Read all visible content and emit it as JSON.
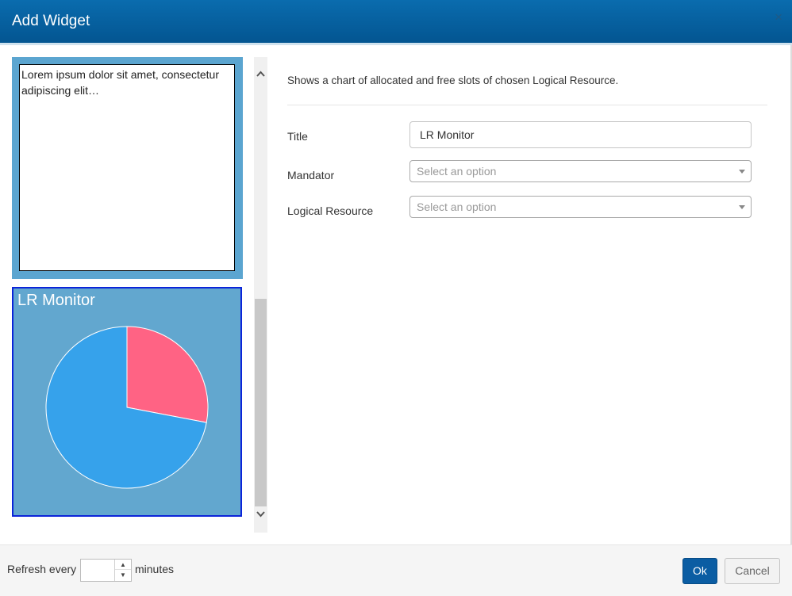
{
  "dialog": {
    "title": "Add Widget",
    "close_glyph": "×"
  },
  "left_pane": {
    "text_tile": {
      "text": "Lorem ipsum dolor sit amet, consectetur adipiscing elit…"
    },
    "chart_tile": {
      "title": "LR Monitor"
    }
  },
  "chart_data": {
    "type": "pie",
    "title": "LR Monitor",
    "slices": [
      {
        "value": 28,
        "color": "#ff6384"
      },
      {
        "value": 72,
        "color": "#36a2eb"
      }
    ],
    "start_angle_deg": -90
  },
  "scrollbar": {
    "up_glyph": "⌃",
    "down_glyph": "⌄"
  },
  "form": {
    "description": "Shows a chart of allocated and free slots of chosen Logical Resource.",
    "title_label": "Title",
    "title_value": "LR Monitor",
    "mandator_label": "Mandator",
    "mandator_placeholder": "Select an option",
    "logical_resource_label": "Logical Resource",
    "logical_resource_placeholder": "Select an option"
  },
  "footer": {
    "refresh_label": "Refresh every",
    "refresh_value": "",
    "minutes_label": "minutes",
    "spin_up": "▲",
    "spin_down": "▼",
    "ok_label": "Ok",
    "cancel_label": "Cancel"
  },
  "colors": {
    "header": "#035591",
    "accent": "#0b5da3",
    "tile": "#62a7cf",
    "selected_border": "#0b24d9"
  }
}
